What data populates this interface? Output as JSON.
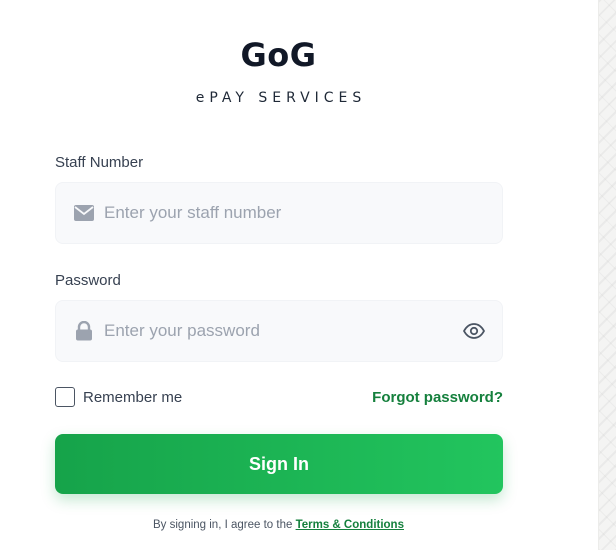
{
  "brand": {
    "title": "GoG",
    "subtitle": "ePAY SERVICES"
  },
  "form": {
    "staff": {
      "label": "Staff Number",
      "placeholder": "Enter your staff number",
      "value": "",
      "icon": "envelope-icon"
    },
    "password": {
      "label": "Password",
      "placeholder": "Enter your password",
      "value": "",
      "icon": "lock-icon",
      "toggle_icon": "eye-icon"
    },
    "remember_label": "Remember me",
    "remember_checked": false,
    "forgot_label": "Forgot password?",
    "submit_label": "Sign In"
  },
  "footer": {
    "agree_prefix": "By signing in, I agree to the",
    "terms_label": "Terms & Conditions"
  },
  "colors": {
    "accent": "#16a34a",
    "accent_light": "#22c55e",
    "link": "#15803d",
    "field_bg": "#f8f9fb",
    "text": "#111827"
  }
}
